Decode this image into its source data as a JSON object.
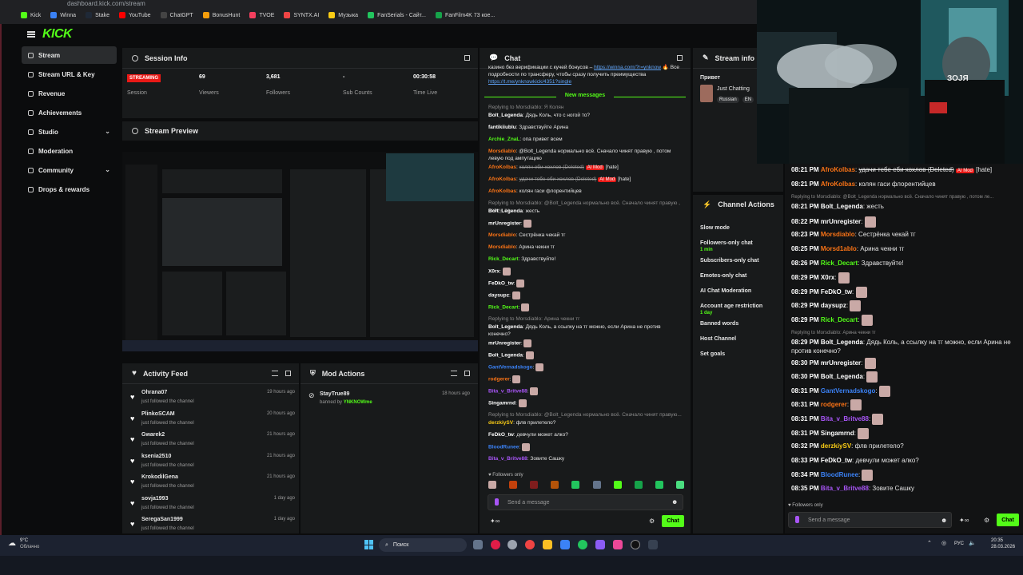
{
  "browser": {
    "address": "dashboard.kick.com/stream",
    "bookmarks": [
      {
        "label": "Kick",
        "color": "#53fc18"
      },
      {
        "label": "Winna",
        "color": "#3b82f6"
      },
      {
        "label": "Stake",
        "color": "#1f2937"
      },
      {
        "label": "YouTube",
        "color": "#ff0000"
      },
      {
        "label": "ChatGPT",
        "color": "#444"
      },
      {
        "label": "BonusHunt",
        "color": "#f59e0b"
      },
      {
        "label": "TVOE",
        "color": "#f43f5e"
      },
      {
        "label": "SYNTX.AI",
        "color": "#ef4444"
      },
      {
        "label": "Музыка",
        "color": "#facc15"
      },
      {
        "label": "FanSerials - Сайт...",
        "color": "#22c55e"
      },
      {
        "label": "FanFilm4K 73 кое...",
        "color": "#16a34a"
      }
    ]
  },
  "brand": {
    "logo": "KICK",
    "accent": "#53fc18"
  },
  "sidebar": {
    "items": [
      {
        "label": "Stream",
        "active": true
      },
      {
        "label": "Stream URL & Key"
      },
      {
        "label": "Revenue"
      },
      {
        "label": "Achievements"
      },
      {
        "label": "Studio",
        "expand": true
      },
      {
        "label": "Moderation"
      },
      {
        "label": "Community",
        "expand": true
      },
      {
        "label": "Drops & rewards"
      }
    ]
  },
  "session": {
    "title": "Session Info",
    "status": "STREAMING",
    "status_label": "Session",
    "stats": [
      {
        "value": "69",
        "label": "Viewers"
      },
      {
        "value": "3,681",
        "label": "Followers"
      },
      {
        "value": "-",
        "label": "Sub Counts"
      },
      {
        "value": "00:30:58",
        "label": "Time Live"
      }
    ]
  },
  "preview": {
    "title": "Stream Preview"
  },
  "activity": {
    "title": "Activity Feed",
    "items": [
      {
        "name": "Ohrana07",
        "sub": "just followed the channel",
        "time": "19 hours ago"
      },
      {
        "name": "PlinkoSCAM",
        "sub": "just followed the channel",
        "time": "20 hours ago"
      },
      {
        "name": "Gwarek2",
        "sub": "just followed the channel",
        "time": "21 hours ago"
      },
      {
        "name": "ksenia2510",
        "sub": "just followed the channel",
        "time": "21 hours ago"
      },
      {
        "name": "KrokodilGena",
        "sub": "just followed the channel",
        "time": "21 hours ago"
      },
      {
        "name": "sovja1993",
        "sub": "just followed the channel",
        "time": "1 day ago"
      },
      {
        "name": "SeregaSan1999",
        "sub": "just followed the channel",
        "time": "1 day ago"
      }
    ]
  },
  "mod": {
    "title": "Mod Actions",
    "user": "StayTrue89",
    "banned_by_prefix": "banned by",
    "banned_by": "YNKNOWme",
    "time": "18 hours ago"
  },
  "chat": {
    "title": "Chat",
    "top_text": "казино без верификации с кучей бонусов –",
    "top_link": "https://winna.com/?r=ynknow",
    "top_text2": "🔥 Все подробности по трансферу, чтобы сразу получить преимущества",
    "top_link2": "https://t.me/ynknowkick/4351?single",
    "new_messages": "New messages",
    "lines": [
      {
        "reply": "Replying to Morsdiablo: Я Колян"
      },
      {
        "user": "Bolt_Legenda",
        "color": "#ffffff",
        "text": "Дядь Коль, что с ногой то?"
      },
      {
        "user": "fantikiiublu",
        "color": "#ffffff",
        "text": "Здравствуйте Арина"
      },
      {
        "user": "Archie_ZnaL",
        "color": "#53fc18",
        "text": "опа привет всем"
      },
      {
        "user": "Morsdiablo",
        "color": "#f97316",
        "text": "@Bolt_Legenda нормально всё. Сначало чинят правую , потом левую под ампутацию"
      },
      {
        "user": "AfroKolbas",
        "color": "#f97316",
        "text": "колян еби хохлов (Deleted)",
        "tag": "AI Mod",
        "tail": "[hate]"
      },
      {
        "user": "AfroKolbas",
        "color": "#f97316",
        "text": "удачи тебе еби хохлов (Deleted)",
        "tag": "AI Mod",
        "tail": "[hate]"
      },
      {
        "user": "AfroKolbas",
        "color": "#f97316",
        "text": "колян гаси флорентийцев"
      },
      {
        "reply": "Replying to Morsdiablo: @Bolt_Legenda нормально всё. Сначало чинят правую , потом ле..."
      },
      {
        "user": "Bolt_Legenda",
        "color": "#ffffff",
        "text": "жесть"
      },
      {
        "user": "mrUnregister",
        "color": "#ffffff",
        "text": ""
      },
      {
        "user": "Morsdiablo",
        "color": "#f97316",
        "text": "Сестрёнка чекай тг"
      },
      {
        "user": "Morsdiablo",
        "color": "#f97316",
        "text": "Арина чекни тг"
      },
      {
        "user": "Rick_Decart",
        "color": "#53fc18",
        "text": "Здравствуйте!"
      },
      {
        "user": "X0rx",
        "color": "#ffffff",
        "text": ""
      },
      {
        "user": "FeDkO_tw",
        "color": "#ffffff",
        "text": ""
      },
      {
        "user": "daysupz",
        "color": "#ffffff",
        "text": ""
      },
      {
        "user": "Rick_Decart",
        "color": "#53fc18",
        "text": ""
      },
      {
        "reply": "Replying to Morsdiablo: Арина чекни тг"
      },
      {
        "user": "Bolt_Legenda",
        "color": "#ffffff",
        "text": "Дядь Коль, а ссылку на тг можно, если Арина не против конечно?"
      },
      {
        "user": "mrUnregister",
        "color": "#ffffff",
        "text": ""
      },
      {
        "user": "Bolt_Legenda",
        "color": "#ffffff",
        "text": ""
      },
      {
        "user": "GantVernadskogo",
        "color": "#3b82f6",
        "text": ""
      },
      {
        "user": "rodgerer",
        "color": "#f97316",
        "text": ""
      },
      {
        "user": "Bita_v_Britve88",
        "color": "#a855f7",
        "text": ""
      },
      {
        "user": "Singamrnd",
        "color": "#ffffff",
        "text": ""
      },
      {
        "reply": "Replying to Morsdiablo: @Bolt_Legenda нормально всё. Сначало чинят правую..."
      },
      {
        "user": "derzkiySV",
        "color": "#facc15",
        "text": "флв прилетело?"
      },
      {
        "user": "FeDkO_tw",
        "color": "#ffffff",
        "text": "девчули может алко?"
      },
      {
        "user": "BloodRunee",
        "color": "#3b82f6",
        "text": ""
      },
      {
        "user": "Bita_v_Britve88",
        "color": "#a855f7",
        "text": "Зовите Сашку"
      }
    ],
    "followers_only": "Followers only",
    "placeholder": "Send a message",
    "send": "Chat"
  },
  "stream_info": {
    "title": "Stream info",
    "prefix": "Привет",
    "category": "Just Chatting",
    "tags": [
      "Russian",
      "EN"
    ]
  },
  "channel_actions": {
    "title": "Channel Actions",
    "items": [
      {
        "label": "Slow mode"
      },
      {
        "label": "Followers-only chat",
        "sub": "1 min"
      },
      {
        "label": "Subscribers-only chat"
      },
      {
        "label": "Emotes-only chat"
      },
      {
        "label": "AI Chat Moderation"
      },
      {
        "label": "Account age restriction",
        "sub": "1 day"
      },
      {
        "label": "Banned words"
      },
      {
        "label": "Host Channel"
      },
      {
        "label": "Set goals"
      }
    ]
  },
  "overlay_chat": {
    "lines": [
      {
        "time": "08:21 PM",
        "user": "AfroKolbas",
        "color": "#f97316",
        "text": "удачи тебе еби хохлов (Deleted)",
        "tag": "AI Mod",
        "tail": "[hate]"
      },
      {
        "time": "08:21 PM",
        "user": "AfroKolbas",
        "color": "#f97316",
        "text": "колян гаси флорентийцев"
      },
      {
        "reply": "Replying to Morsdiablo: @Bolt_Legenda нормально всё. Сначало чинят правую , потом ле..."
      },
      {
        "time": "08:21 PM",
        "user": "Bolt_Legenda",
        "color": "#ffffff",
        "text": "жесть"
      },
      {
        "time": "08:22 PM",
        "user": "mrUnregister",
        "color": "#ffffff",
        "text": ""
      },
      {
        "time": "08:23 PM",
        "user": "Morsdiablo",
        "color": "#f97316",
        "text": "Сестрёнка чекай тг"
      },
      {
        "time": "08:25 PM",
        "user": "Morsd1ablo",
        "color": "#f97316",
        "text": "Арина чекни тг"
      },
      {
        "time": "08:26 PM",
        "user": "Rick_Decart",
        "color": "#53fc18",
        "text": "Здравствуйте!"
      },
      {
        "time": "08:29 PM",
        "user": "X0rx",
        "color": "#ffffff",
        "text": ""
      },
      {
        "time": "08:29 PM",
        "user": "FeDkO_tw",
        "color": "#ffffff",
        "text": ""
      },
      {
        "time": "08:29 PM",
        "user": "daysupz",
        "color": "#ffffff",
        "text": ""
      },
      {
        "time": "08:29 PM",
        "user": "Rick_Decart",
        "color": "#53fc18",
        "text": ""
      },
      {
        "reply": "Replying to Morsdiablo: Арина чекни тг"
      },
      {
        "time": "08:29 PM",
        "user": "Bolt_Legenda",
        "color": "#ffffff",
        "text": "Дядь Коль, а ссылку на тг можно, если Арина не против конечно?"
      },
      {
        "time": "08:30 PM",
        "user": "mrUnregister",
        "color": "#ffffff",
        "text": ""
      },
      {
        "time": "08:30 PM",
        "user": "Bolt_Legenda",
        "color": "#ffffff",
        "text": ""
      },
      {
        "time": "08:31 PM",
        "user": "GantVernadskogo",
        "color": "#3b82f6",
        "text": ""
      },
      {
        "time": "08:31 PM",
        "user": "rodgerer",
        "color": "#f97316",
        "text": ""
      },
      {
        "time": "08:31 PM",
        "user": "Bita_v_Britve88",
        "color": "#a855f7",
        "text": ""
      },
      {
        "time": "08:31 PM",
        "user": "Singamrnd",
        "color": "#ffffff",
        "text": ""
      },
      {
        "time": "08:32 PM",
        "user": "derzkiySV",
        "color": "#facc15",
        "text": "флв прилетело?"
      },
      {
        "time": "08:33 PM",
        "user": "FeDkO_tw",
        "color": "#ffffff",
        "text": "девчули может алко?"
      },
      {
        "time": "08:34 PM",
        "user": "BloodRunee",
        "color": "#3b82f6",
        "text": ""
      },
      {
        "time": "08:35 PM",
        "user": "Bita_v_Britve88",
        "color": "#a855f7",
        "text": "Зовите Сашку"
      }
    ],
    "followers_only": "Followers only",
    "placeholder": "Send a message",
    "send": "Chat"
  },
  "webcam": {
    "overlay_text": "ЗОЈЯ"
  },
  "taskbar": {
    "weather_temp": "9°C",
    "weather_text": "Облачно",
    "search": "Поиск",
    "lang": "РУС",
    "time": "20:35",
    "date": "28.03.2026"
  }
}
